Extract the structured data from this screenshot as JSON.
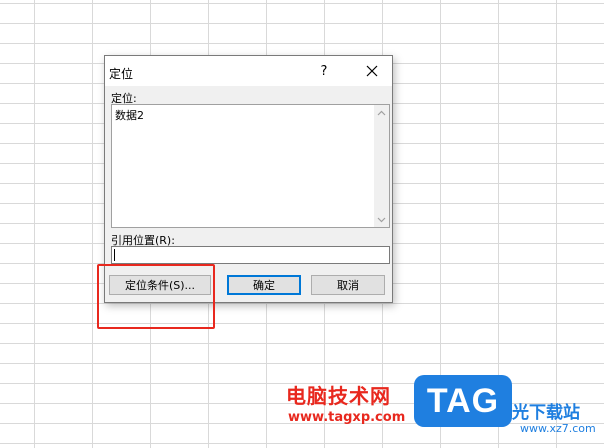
{
  "dialog": {
    "title": "定位",
    "help_glyph": "?",
    "goto_label": "定位:",
    "list_items": [
      "数据2"
    ],
    "reference_label": "引用位置(R):",
    "reference_value": "",
    "special_button": "定位条件(S)...",
    "ok_button": "确定",
    "cancel_button": "取消"
  },
  "watermark": {
    "brand_text": "电脑技术网",
    "brand_url": "www.tagxp.com",
    "badge_text": "TAG",
    "site_text": "光下载站",
    "site_url": "www.xz7.com"
  },
  "colors": {
    "highlight": "#e8281e",
    "accent": "#0078d7",
    "watermark_blue": "#1f7fe0"
  },
  "icons": [
    "close-icon",
    "scroll-up-icon",
    "scroll-down-icon"
  ]
}
